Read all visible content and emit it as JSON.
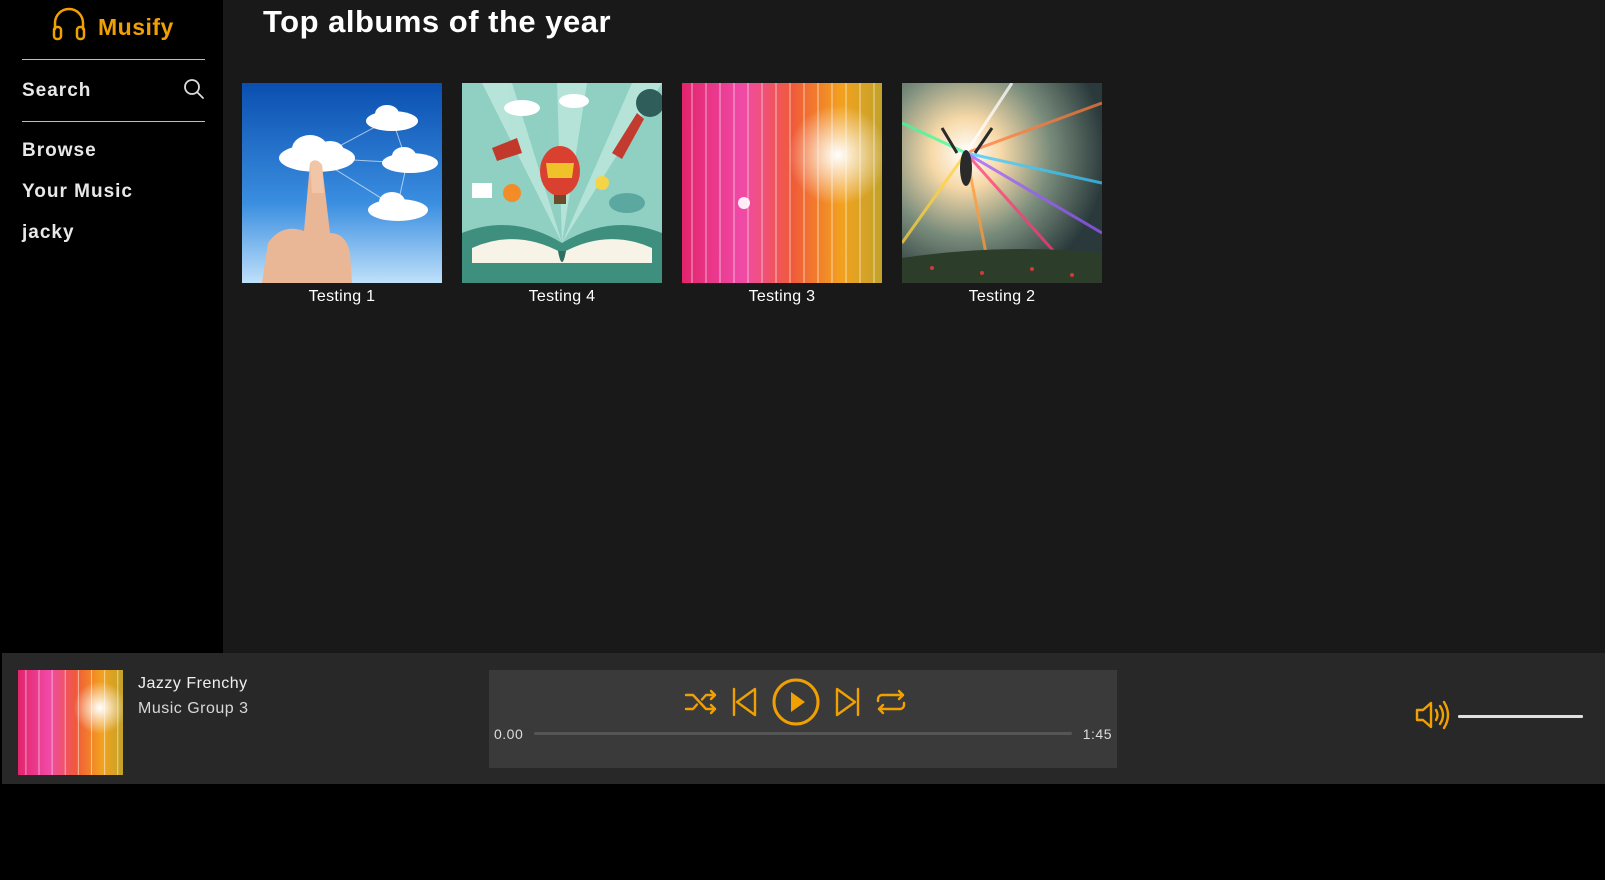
{
  "app": {
    "name": "Musify"
  },
  "sidebar": {
    "search_label": "Search",
    "items": [
      {
        "label": "Browse"
      },
      {
        "label": "Your Music"
      },
      {
        "label": "jacky"
      }
    ]
  },
  "main": {
    "title": "Top albums of the year",
    "albums": [
      {
        "title": "Testing 1",
        "art": "cloud-touch"
      },
      {
        "title": "Testing 4",
        "art": "storybook-balloon"
      },
      {
        "title": "Testing 3",
        "art": "pink-sparkle-lines"
      },
      {
        "title": "Testing 2",
        "art": "light-burst"
      }
    ]
  },
  "player": {
    "track_title": "Jazzy Frenchy",
    "track_artist": "Music Group 3",
    "time_current": "0.00",
    "time_total": "1:45",
    "progress": 0,
    "volume": 1.0,
    "icons": [
      "headphones-icon",
      "search-icon",
      "shuffle-icon",
      "previous-icon",
      "play-icon",
      "next-icon",
      "repeat-icon",
      "volume-icon"
    ]
  },
  "colors": {
    "accent": "#f0a000",
    "sidebar_bg": "#000000",
    "main_bg": "#191919",
    "player_bg": "#282828",
    "controls_bg": "#3a3a3a"
  }
}
